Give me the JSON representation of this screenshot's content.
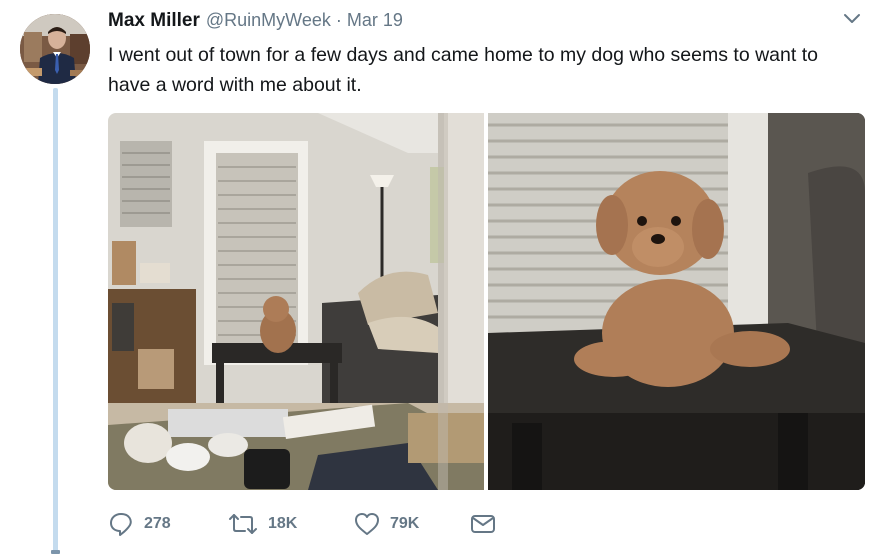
{
  "tweet": {
    "author_name": "Max Miller",
    "handle": "@RuinMyWeek",
    "separator": "·",
    "date": "Mar 19",
    "text": "I went out of town for a few days and came home to my dog who seems to want to have a word with me about it."
  },
  "actions": {
    "reply_count": "278",
    "retweet_count": "18K",
    "like_count": "79K"
  },
  "icons": {
    "caret": "chevron-down-icon",
    "reply": "reply-icon",
    "retweet": "retweet-icon",
    "like": "heart-icon",
    "dm": "envelope-icon"
  },
  "colors": {
    "text": "#14171a",
    "secondary": "#657786",
    "thread_line": "#c4dbee"
  }
}
